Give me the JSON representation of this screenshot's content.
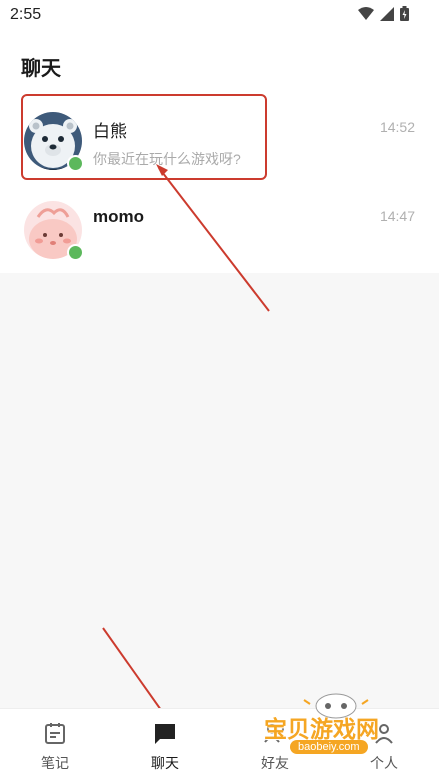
{
  "status_bar": {
    "time": "2:55"
  },
  "page": {
    "title": "聊天"
  },
  "chats": [
    {
      "name": "白熊",
      "preview": "你最近在玩什么游戏呀?",
      "time": "14:52",
      "online": true
    },
    {
      "name": "momo",
      "preview": "",
      "time": "14:47",
      "online": true
    }
  ],
  "bottom_nav": [
    {
      "label": "笔记",
      "icon": "calendar-icon",
      "active": false
    },
    {
      "label": "聊天",
      "icon": "chat-bubble-icon",
      "active": true
    },
    {
      "label": "好友",
      "icon": "friends-icon",
      "active": false
    },
    {
      "label": "个人",
      "icon": "person-icon",
      "active": false
    }
  ],
  "watermark": {
    "text": "宝贝游戏网",
    "url": "baobeiy.com"
  },
  "colors": {
    "online": "#5cb85c",
    "annotation": "#cc3b2e",
    "watermark": "#f5a623"
  }
}
